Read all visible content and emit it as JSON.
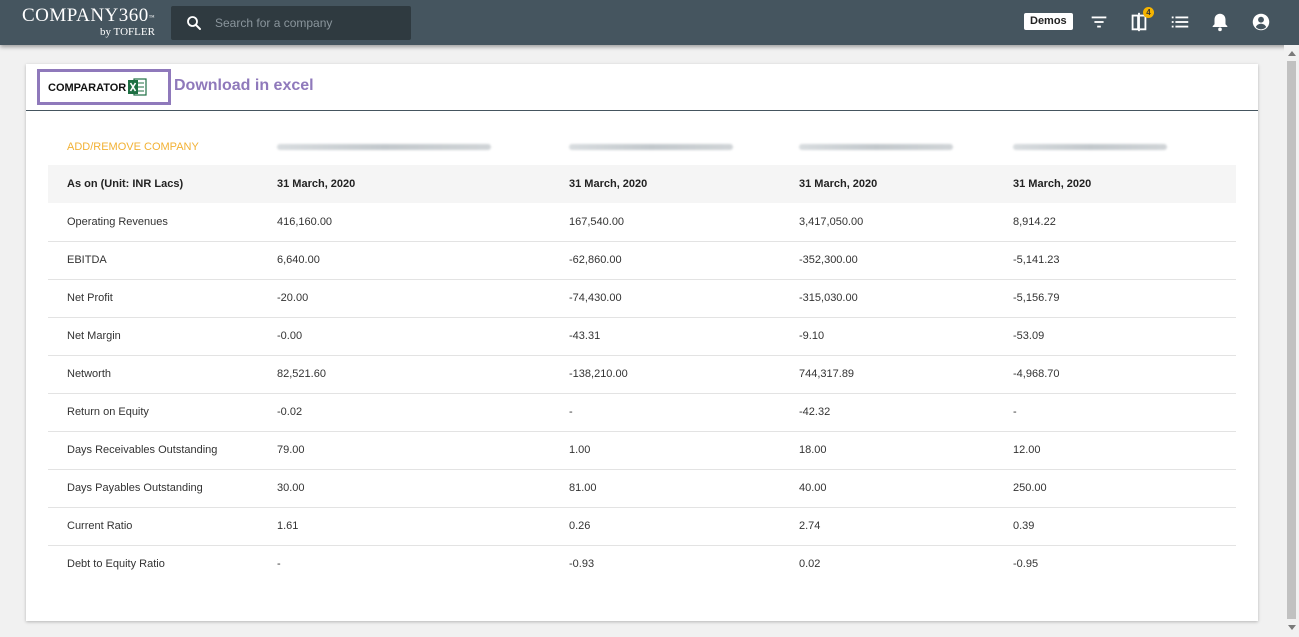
{
  "header": {
    "logo_main": "COMPANY360",
    "logo_tm": "™",
    "logo_sub": "by TOFLER",
    "search_placeholder": "Search for a company",
    "demos_label": "Demos",
    "compare_badge": "4",
    "icons": [
      "search-icon",
      "filter-icon",
      "compare-icon",
      "list-icon",
      "bell-icon",
      "account-circle-icon"
    ]
  },
  "card": {
    "comparator_label": "COMPARATOR",
    "excel_icon": "excel-icon",
    "download_note": "Download in excel"
  },
  "table": {
    "add_remove_label": "ADD/REMOVE COMPANY",
    "header_label": "As on (Unit: INR Lacs)",
    "dates": [
      "31 March, 2020",
      "31 March, 2020",
      "31 March, 2020",
      "31 March, 2020"
    ],
    "rows": [
      {
        "label": "Operating Revenues",
        "values": [
          "416,160.00",
          "167,540.00",
          "3,417,050.00",
          "8,914.22"
        ]
      },
      {
        "label": "EBITDA",
        "values": [
          "6,640.00",
          "-62,860.00",
          "-352,300.00",
          "-5,141.23"
        ]
      },
      {
        "label": "Net Profit",
        "values": [
          "-20.00",
          "-74,430.00",
          "-315,030.00",
          "-5,156.79"
        ]
      },
      {
        "label": "Net Margin",
        "values": [
          "-0.00",
          "-43.31",
          "-9.10",
          "-53.09"
        ]
      },
      {
        "label": "Networth",
        "values": [
          "82,521.60",
          "-138,210.00",
          "744,317.89",
          "-4,968.70"
        ]
      },
      {
        "label": "Return on Equity",
        "values": [
          "-0.02",
          "-",
          "-42.32",
          "-"
        ]
      },
      {
        "label": "Days Receivables Outstanding",
        "values": [
          "79.00",
          "1.00",
          "18.00",
          "12.00"
        ]
      },
      {
        "label": "Days Payables Outstanding",
        "values": [
          "30.00",
          "81.00",
          "40.00",
          "250.00"
        ]
      },
      {
        "label": "Current Ratio",
        "values": [
          "1.61",
          "0.26",
          "2.74",
          "0.39"
        ]
      },
      {
        "label": "Debt to Equity Ratio",
        "values": [
          "-",
          "-0.93",
          "0.02",
          "-0.95"
        ]
      }
    ]
  },
  "colors": {
    "topbar": "#45555f",
    "accent_purple": "#8f79bb",
    "add_link": "#f2b134",
    "badge": "#f6b400"
  }
}
